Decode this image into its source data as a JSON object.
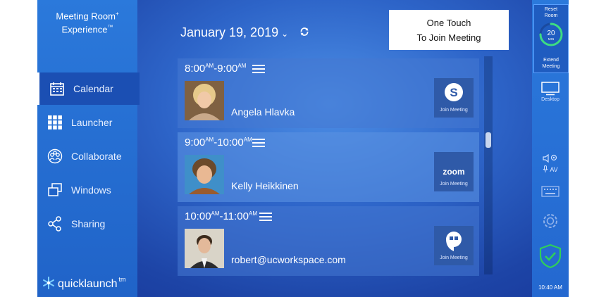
{
  "brand": {
    "line1": "Meeting Room",
    "line1_sup": "+",
    "line2": "Experience",
    "line2_sup": "™"
  },
  "sidebar": {
    "items": [
      {
        "label": "Calendar",
        "icon": "calendar-icon",
        "active": true
      },
      {
        "label": "Launcher",
        "icon": "grid-icon",
        "active": false
      },
      {
        "label": "Collaborate",
        "icon": "people-icon",
        "active": false
      },
      {
        "label": "Windows",
        "icon": "windows-icon",
        "active": false
      },
      {
        "label": "Sharing",
        "icon": "share-icon",
        "active": false
      }
    ]
  },
  "logo": {
    "text": "quicklaunch",
    "tm": "tm"
  },
  "header": {
    "date": "January 19, 2019",
    "chevron": "⌄"
  },
  "one_touch": {
    "line1": "One Touch",
    "line2": "To Join Meeting"
  },
  "meetings": [
    {
      "start": "8:00",
      "start_sup": "AM",
      "sep": "-",
      "end": "9:00",
      "end_sup": "AM",
      "name": "Angela Hlavka",
      "service": "skype",
      "join_label": "Join Meeting"
    },
    {
      "start": "9:00",
      "start_sup": "AM",
      "sep": "-",
      "end": "10:00",
      "end_sup": "AM",
      "name": "Kelly Heikkinen",
      "service": "zoom",
      "service_text": "zoom",
      "join_label": "Join Meeting"
    },
    {
      "start": "10:00",
      "start_sup": "AM",
      "sep": "-",
      "end": "11:00",
      "end_sup": "AM",
      "name": "robert@ucworkspace.com",
      "service": "hangouts",
      "join_label": "Join Meeting"
    }
  ],
  "rail": {
    "reset_line1": "Reset",
    "reset_line2": "Room",
    "timer_value": "20",
    "timer_unit": "MIN",
    "timer_fraction": 0.75,
    "extend_line1": "Extend",
    "extend_line2": "Meeting",
    "desktop_label": "Desktop",
    "av_label": "AV",
    "clock": "10:40 AM"
  },
  "colors": {
    "accent": "#2b79db",
    "timer_green": "#3ddc84",
    "shield_green": "#2fcf5a"
  }
}
